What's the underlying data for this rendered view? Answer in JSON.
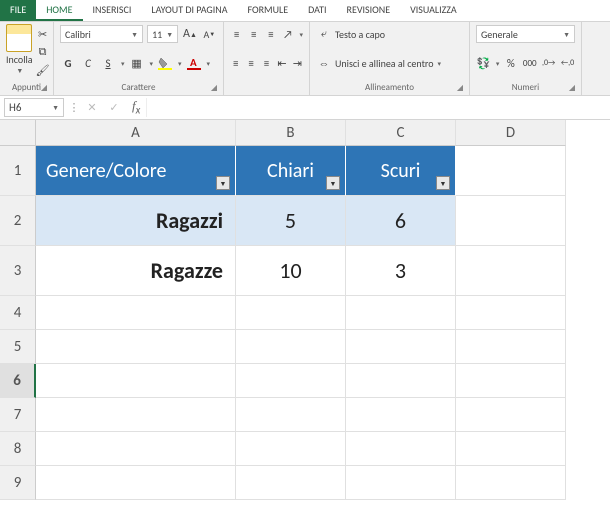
{
  "tabs": {
    "file": "FILE",
    "home": "HOME",
    "insert": "INSERISCI",
    "layout": "LAYOUT DI PAGINA",
    "formulas": "FORMULE",
    "data": "DATI",
    "review": "REVISIONE",
    "view": "VISUALIZZA"
  },
  "ribbon": {
    "clipboard": {
      "paste": "Incolla",
      "label": "Appunti"
    },
    "font": {
      "name": "Calibri",
      "size": "11",
      "bold": "G",
      "italic": "C",
      "underline": "S",
      "label": "Carattere"
    },
    "alignment": {
      "wrap": "Testo a capo",
      "merge": "Unisci e allinea al centro",
      "label": "Allineamento"
    },
    "number": {
      "format": "Generale",
      "label": "Numeri"
    }
  },
  "namebox": "H6",
  "columns": [
    "A",
    "B",
    "C",
    "D"
  ],
  "rows": [
    "1",
    "2",
    "3",
    "4",
    "5",
    "6",
    "7",
    "8",
    "9"
  ],
  "table": {
    "headers": [
      "Genere/Colore",
      "Chiari",
      "Scuri"
    ],
    "data": [
      {
        "label": "Ragazzi",
        "chiari": "5",
        "scuri": "6"
      },
      {
        "label": "Ragazze",
        "chiari": "10",
        "scuri": "3"
      }
    ]
  },
  "chart_data": {
    "type": "table",
    "title": "Genere/Colore",
    "categories": [
      "Chiari",
      "Scuri"
    ],
    "series": [
      {
        "name": "Ragazzi",
        "values": [
          5,
          6
        ]
      },
      {
        "name": "Ragazze",
        "values": [
          10,
          3
        ]
      }
    ]
  }
}
